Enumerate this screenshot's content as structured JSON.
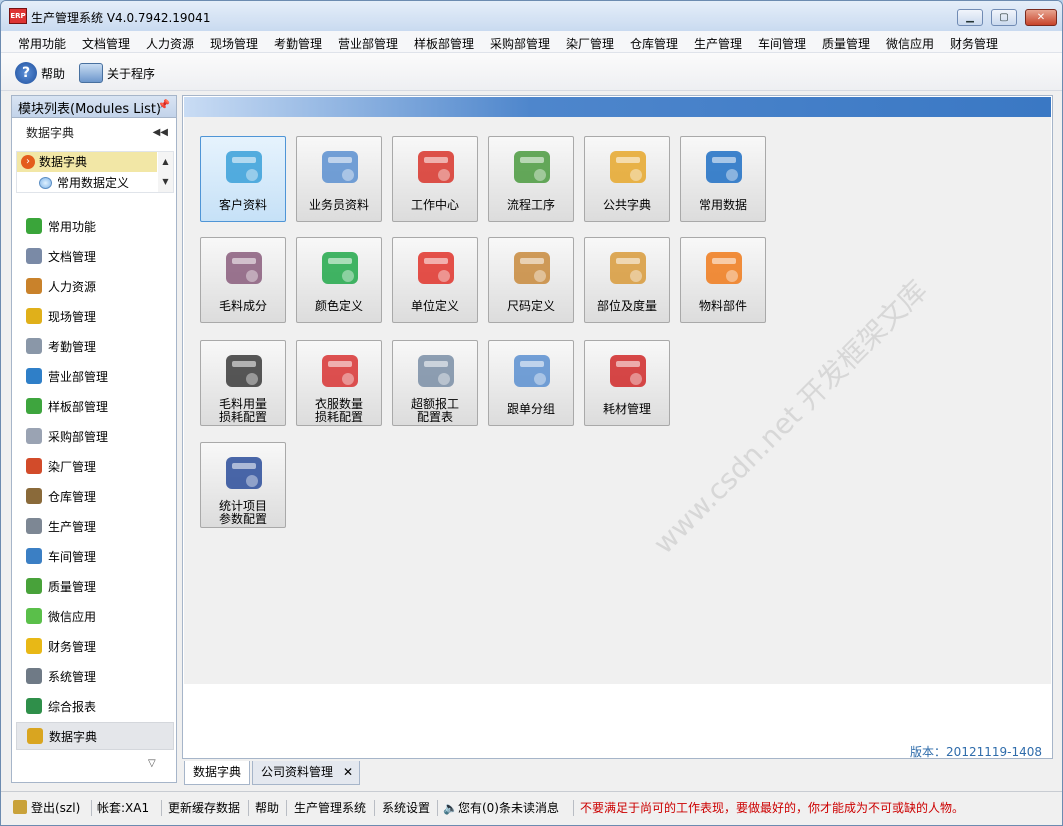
{
  "window": {
    "title": "生产管理系统 V4.0.7942.19041",
    "app_icon_text": "ERP"
  },
  "menu": [
    "常用功能",
    "文档管理",
    "人力资源",
    "现场管理",
    "考勤管理",
    "营业部管理",
    "样板部管理",
    "采购部管理",
    "染厂管理",
    "仓库管理",
    "生产管理",
    "车间管理",
    "质量管理",
    "微信应用",
    "财务管理"
  ],
  "toolbar": {
    "help": "帮助",
    "about": "关于程序"
  },
  "sidebar": {
    "title": "模块列表(Modules List)",
    "section": "数据字典",
    "tree": {
      "root": "数据字典",
      "child": "常用数据定义"
    },
    "nav": [
      {
        "label": "常用功能",
        "icon": "grid-icon",
        "color": "#3aa53a"
      },
      {
        "label": "文档管理",
        "icon": "document-icon",
        "color": "#7a8aa6"
      },
      {
        "label": "人力资源",
        "icon": "people-icon",
        "color": "#c9822b"
      },
      {
        "label": "现场管理",
        "icon": "crown-icon",
        "color": "#e0b01a"
      },
      {
        "label": "考勤管理",
        "icon": "clock-icon",
        "color": "#8a97a8"
      },
      {
        "label": "营业部管理",
        "icon": "globe-icon",
        "color": "#2f7fc8"
      },
      {
        "label": "样板部管理",
        "icon": "puzzle-icon",
        "color": "#3ea53e"
      },
      {
        "label": "采购部管理",
        "icon": "list-icon",
        "color": "#9aa3b3"
      },
      {
        "label": "染厂管理",
        "icon": "pie-icon",
        "color": "#d24b2a"
      },
      {
        "label": "仓库管理",
        "icon": "box-icon",
        "color": "#8a6a3a"
      },
      {
        "label": "生产管理",
        "icon": "wrench-icon",
        "color": "#7d8794"
      },
      {
        "label": "车间管理",
        "icon": "org-chart-icon",
        "color": "#3b7fc4"
      },
      {
        "label": "质量管理",
        "icon": "flag-icon",
        "color": "#48a23a"
      },
      {
        "label": "微信应用",
        "icon": "wechat-icon",
        "color": "#5abf4a"
      },
      {
        "label": "财务管理",
        "icon": "shield-icon",
        "color": "#e8b816"
      },
      {
        "label": "系统管理",
        "icon": "tools-icon",
        "color": "#6f7a86"
      },
      {
        "label": "综合报表",
        "icon": "bar-chart-icon",
        "color": "#2f8f4a"
      },
      {
        "label": "数据字典",
        "icon": "dictionary-icon",
        "color": "#d9a520"
      }
    ],
    "active_index": 17
  },
  "tiles": [
    {
      "label": "客户资料",
      "icon": "customers-icon",
      "color": "#3aa0d8"
    },
    {
      "label": "业务员资料",
      "icon": "salesman-icon",
      "color": "#5a8fd0"
    },
    {
      "label": "工作中心",
      "icon": "org-chart-icon",
      "color": "#d8342a"
    },
    {
      "label": "流程工序",
      "icon": "flowchart-icon",
      "color": "#4a9a3e"
    },
    {
      "label": "公共字典",
      "icon": "dictionary-icon",
      "color": "#e6a72a"
    },
    {
      "label": "常用数据",
      "icon": "info-icon",
      "color": "#1d6fc4"
    },
    {
      "label": "毛料成分",
      "icon": "yarn-icon",
      "color": "#8a5d7c"
    },
    {
      "label": "颜色定义",
      "icon": "shapes-icon",
      "color": "#21a84a"
    },
    {
      "label": "单位定义",
      "icon": "hierarchy-icon",
      "color": "#e0322a"
    },
    {
      "label": "尺码定义",
      "icon": "ruler-icon",
      "color": "#c88a3c"
    },
    {
      "label": "部位及度量",
      "icon": "ruler-pencil-icon",
      "color": "#d89a3a"
    },
    {
      "label": "物料部件",
      "icon": "sweater-icon",
      "color": "#f07a1a"
    },
    {
      "label": "毛料用量\n损耗配置",
      "icon": "yarn-cone-icon",
      "color": "#3a3a3a"
    },
    {
      "label": "衣服数量\n损耗配置",
      "icon": "shirt-scissors-icon",
      "color": "#d83232"
    },
    {
      "label": "超额报工\n配置表",
      "icon": "question-icon",
      "color": "#7a8ea6"
    },
    {
      "label": "跟单分组",
      "icon": "group-icon",
      "color": "#5a8fd0"
    },
    {
      "label": "耗材管理",
      "icon": "knife-icon",
      "color": "#d02828"
    },
    {
      "label": "统计项目\n参数配置",
      "icon": "formula-icon",
      "color": "#2a4c9a"
    }
  ],
  "version": "版本：20121119-1408",
  "watermark": "www.csdn.net 开发框架文库",
  "tabs": [
    {
      "label": "数据字典"
    },
    {
      "label": "公司资料管理"
    }
  ],
  "status": {
    "logout": "登出(szl)",
    "account": "帐套:XA1",
    "refresh": "更新缓存数据",
    "help": "帮助",
    "system": "生产管理系统",
    "settings": "系统设置",
    "messages": "您有(0)条未读消息",
    "motto": "不要满足于尚可的工作表现，要做最好的，你才能成为不可或缺的人物。"
  }
}
